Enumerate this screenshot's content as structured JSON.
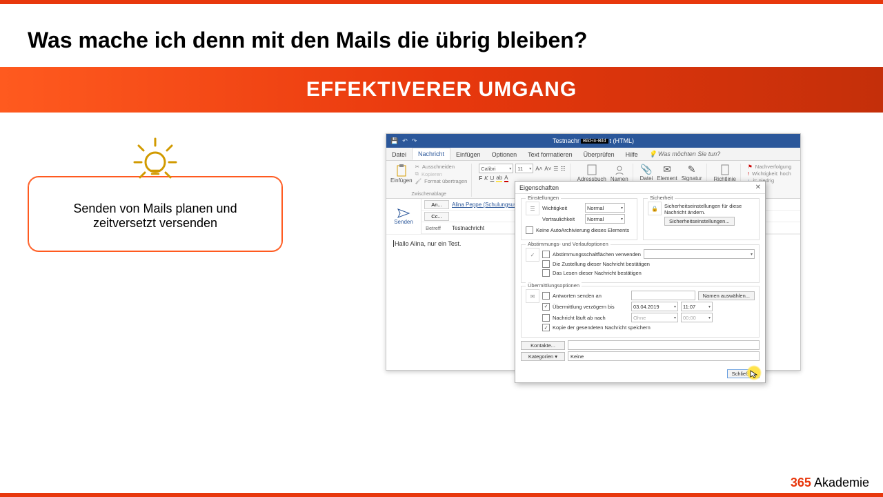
{
  "page": {
    "title": "Was mache ich denn mit den Mails die übrig bleiben?",
    "banner": "EFFEKTIVERER UMGANG",
    "tip_text": "Senden von Mails planen und zeitversetzt versenden"
  },
  "footer": {
    "brand_num": "365",
    "brand_name": " Akademie"
  },
  "outlook": {
    "title_suffix": "t (HTML)",
    "title_prefix": "Testnachr",
    "title_badge": "Bild-in-Bild",
    "tabs": {
      "datei": "Datei",
      "nachricht": "Nachricht",
      "einfuegen": "Einfügen",
      "optionen": "Optionen",
      "text": "Text formatieren",
      "ueberpruefen": "Überprüfen",
      "hilfe": "Hilfe",
      "tell": "Was möchten Sie tun?"
    },
    "ribbon": {
      "einfuegen": "Einfügen",
      "ausschneiden": "Ausschneiden",
      "kopieren": "Kopieren",
      "format_uebertragen": "Format übertragen",
      "zwischenablage": "Zwischenablage",
      "font": "Calibri",
      "size": "11",
      "adressbuch": "Adressbuch",
      "namen": "Namen",
      "datei": "Datei",
      "element": "Element",
      "signatur": "Signatur",
      "richtlinie": "Richtlinie",
      "nachverfolgung": "Nachverfolgung",
      "wichtig_hoch": "Wichtigkeit: hoch",
      "wichtig_niedrig": "it: niedrig"
    },
    "send": "Senden",
    "fields": {
      "an_btn": "An...",
      "an_val": "Alina Peppe (Schulungsuser)",
      "cc_btn": "Cc...",
      "betreff_label": "Betreff",
      "betreff_val": "Testnachricht"
    },
    "body": "Hallo Alina, nur ein Test."
  },
  "props": {
    "title": "Eigenschaften",
    "einstellungen": "Einstellungen",
    "wichtigkeit": "Wichtigkeit",
    "wichtigkeit_val": "Normal",
    "vertraulichkeit": "Vertraulichkeit",
    "vertraulichkeit_val": "Normal",
    "autoarchiv": "Keine AutoArchivierung dieses Elements",
    "sicherheit": "Sicherheit",
    "sich_text": "Sicherheitseinstellungen für diese Nachricht ändern.",
    "sich_btn": "Sicherheitseinstellungen...",
    "abstimmung": "Abstimmungs- und Verlaufoptionen",
    "abst_verwenden": "Abstimmungsschaltflächen verwenden",
    "zustellung_best": "Die Zustellung dieser Nachricht bestätigen",
    "lesen_best": "Das Lesen dieser Nachricht bestätigen",
    "uebermittlung": "Übermittlungsoptionen",
    "antworten": "Antworten senden an",
    "namen_btn": "Namen auswählen...",
    "verzoegern": "Übermittlung verzögern bis",
    "verz_date": "03.04.2019",
    "verz_time": "11:07",
    "ablauf": "Nachricht läuft ab nach",
    "ablauf_date": "Ohne",
    "ablauf_time": "00:00",
    "kopie": "Kopie der gesendeten Nachricht speichern",
    "kontakte": "Kontakte...",
    "kategorien": "Kategorien  ▾",
    "kategorien_val": "Keine",
    "schliessen": "Schließen"
  }
}
